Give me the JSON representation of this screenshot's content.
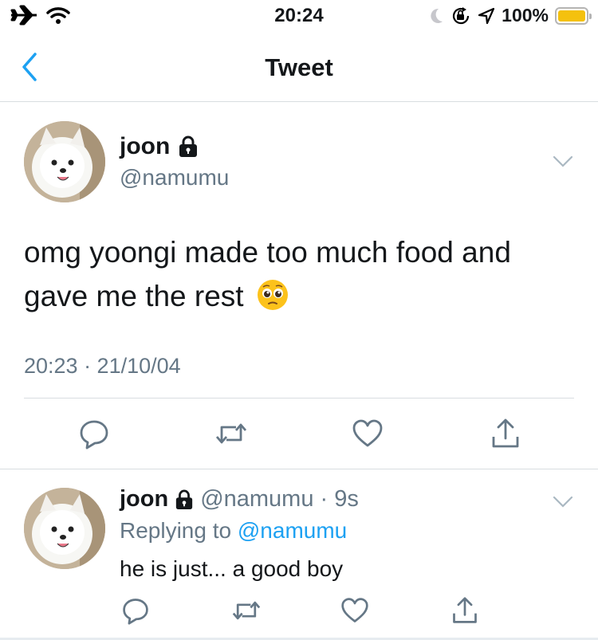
{
  "status_bar": {
    "time": "20:24",
    "battery_percent": "100%",
    "battery_level": 1.0,
    "battery_color": "#f4c10e"
  },
  "header": {
    "title": "Tweet"
  },
  "tweet": {
    "display_name": "joon",
    "handle": "@namumu",
    "text": "omg yoongi made too much food and gave me the rest",
    "emoji": "pleading-face",
    "timestamp": "20:23 · 21/10/04"
  },
  "reply": {
    "display_name": "joon",
    "handle": "@namumu",
    "age": "· 9s",
    "replying_prefix": "Replying to",
    "replying_to": "@namumu",
    "text": "he is just... a good boy"
  },
  "colors": {
    "accent": "#1da1f2",
    "secondary_text": "#657786",
    "icon_gray": "#657786",
    "divider": "#d8dde0"
  },
  "icons": [
    "airplane-icon",
    "wifi-icon",
    "moon-icon",
    "orientation-lock-icon",
    "location-icon",
    "battery-icon",
    "back-chevron-icon",
    "lock-icon",
    "chevron-down-icon",
    "reply-icon",
    "retweet-icon",
    "like-icon",
    "share-icon"
  ]
}
